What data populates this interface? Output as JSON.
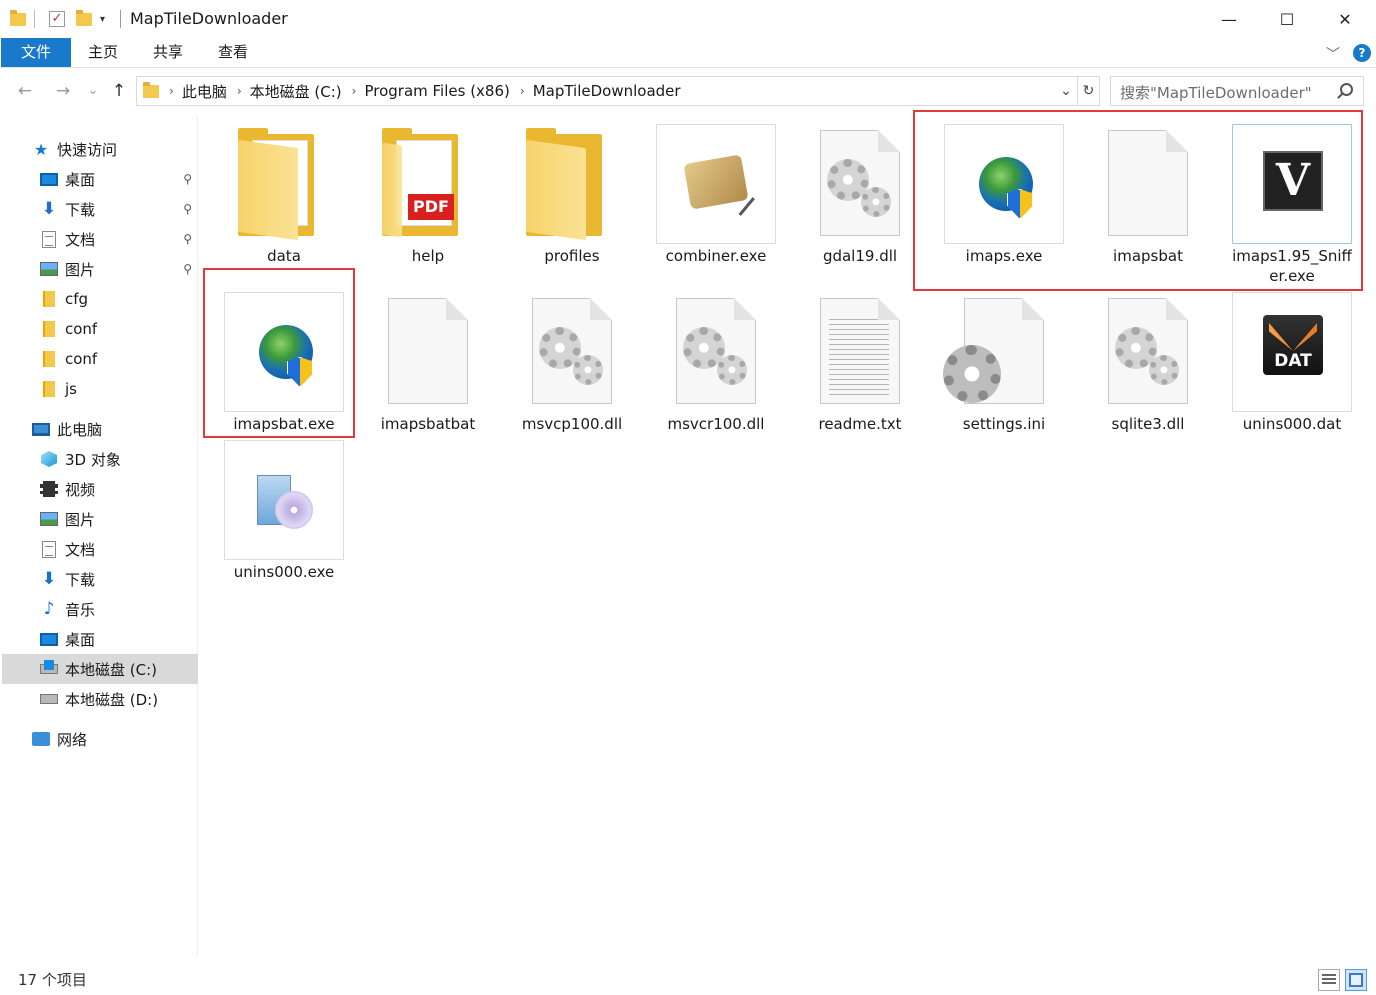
{
  "window": {
    "title": "MapTileDownloader",
    "minimize": "—",
    "maximize": "☐",
    "close": "✕"
  },
  "ribbon": {
    "tabs": [
      "文件",
      "主页",
      "共享",
      "查看"
    ],
    "expand": "﹀",
    "help": "?"
  },
  "nav": {
    "back": "←",
    "forward": "→",
    "recent": "⌄",
    "up": "↑"
  },
  "address": {
    "crumbs": [
      "此电脑",
      "本地磁盘 (C:)",
      "Program Files (x86)",
      "MapTileDownloader"
    ],
    "dropdown": "⌄",
    "refresh": "↻"
  },
  "search": {
    "placeholder": "搜索\"MapTileDownloader\""
  },
  "sidebar": {
    "quick_access": "快速访问",
    "items": [
      {
        "label": "桌面",
        "icon": "desktop-icon",
        "pinned": true
      },
      {
        "label": "下载",
        "icon": "download-icon",
        "pinned": true
      },
      {
        "label": "文档",
        "icon": "document-icon",
        "pinned": true
      },
      {
        "label": "图片",
        "icon": "pictures-icon",
        "pinned": true
      },
      {
        "label": "cfg",
        "icon": "folder-icon"
      },
      {
        "label": "conf",
        "icon": "folder-icon"
      },
      {
        "label": "conf",
        "icon": "folder-icon"
      },
      {
        "label": "js",
        "icon": "folder-icon"
      }
    ],
    "this_pc": "此电脑",
    "pc_items": [
      {
        "label": "3D 对象",
        "icon": "3d-objects-icon"
      },
      {
        "label": "视频",
        "icon": "video-icon"
      },
      {
        "label": "图片",
        "icon": "pictures-icon"
      },
      {
        "label": "文档",
        "icon": "document-icon"
      },
      {
        "label": "下载",
        "icon": "download-icon"
      },
      {
        "label": "音乐",
        "icon": "music-icon"
      },
      {
        "label": "桌面",
        "icon": "desktop-icon"
      },
      {
        "label": "本地磁盘 (C:)",
        "icon": "drive-c-icon",
        "selected": true
      },
      {
        "label": "本地磁盘 (D:)",
        "icon": "drive-d-icon"
      }
    ],
    "network": "网络",
    "pin_glyph": "📌"
  },
  "files": [
    {
      "name": "data",
      "type": "folder"
    },
    {
      "name": "help",
      "type": "folder-pdf"
    },
    {
      "name": "profiles",
      "type": "folder"
    },
    {
      "name": "combiner.exe",
      "type": "exe-map"
    },
    {
      "name": "gdal19.dll",
      "type": "dll"
    },
    {
      "name": "imaps.exe",
      "type": "exe-globe"
    },
    {
      "name": "imapsbat",
      "type": "blank"
    },
    {
      "name": "imaps1.95_Sniffer.exe",
      "name_line1": "imaps1.95_Sniff",
      "name_line2": "er.exe",
      "type": "exe-v"
    },
    {
      "name": "imapsbat.exe",
      "type": "exe-globe"
    },
    {
      "name": "imapsbatbat",
      "type": "blank"
    },
    {
      "name": "msvcp100.dll",
      "type": "dll"
    },
    {
      "name": "msvcr100.dll",
      "type": "dll"
    },
    {
      "name": "readme.txt",
      "type": "txt"
    },
    {
      "name": "settings.ini",
      "type": "ini"
    },
    {
      "name": "sqlite3.dll",
      "type": "dll"
    },
    {
      "name": "unins000.dat",
      "type": "dat"
    },
    {
      "name": "unins000.exe",
      "type": "installer"
    }
  ],
  "icon_text": {
    "pdf": "PDF",
    "v": "V",
    "dat": "DAT"
  },
  "status": {
    "count": "17 个项目"
  },
  "colors": {
    "accent": "#1979ca",
    "highlight_box": "#e03a3a",
    "selected_nav": "#d9d9d9"
  }
}
